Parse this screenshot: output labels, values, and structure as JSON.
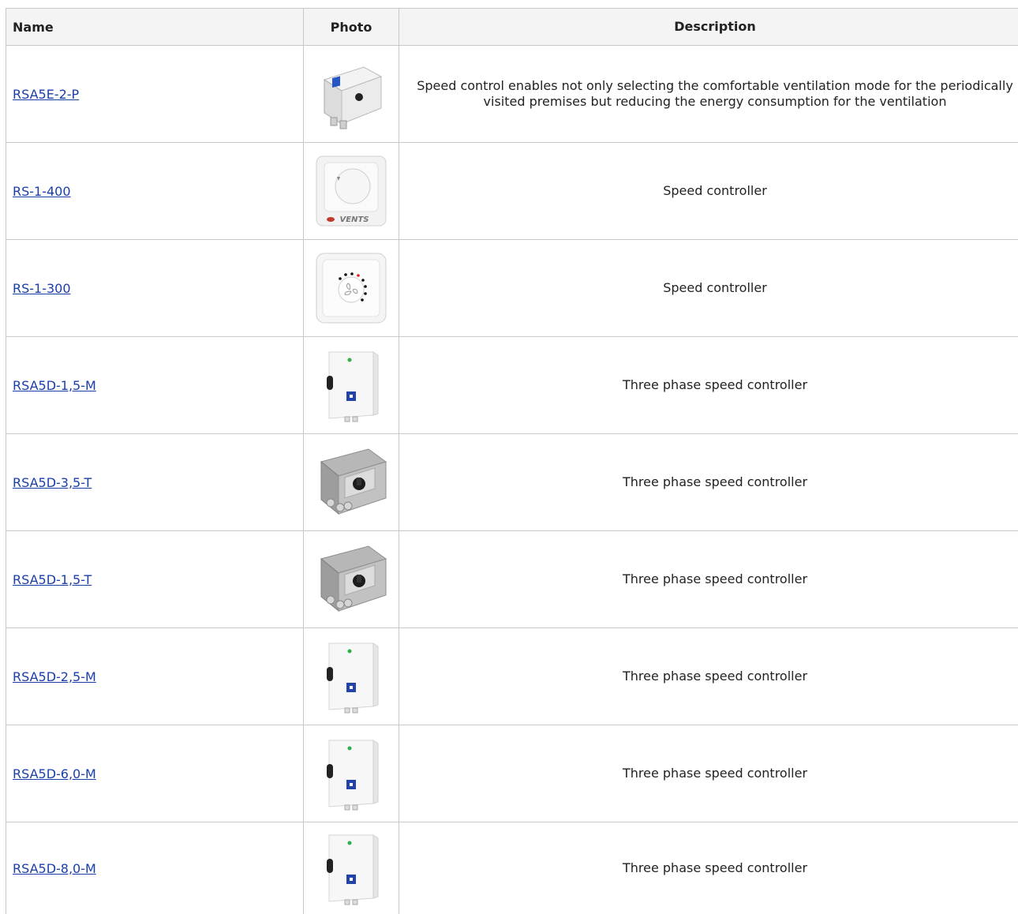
{
  "columns": {
    "name": "Name",
    "photo": "Photo",
    "description": "Description"
  },
  "rows": [
    {
      "name": "RSA5E-2-P",
      "photo_icon": "surface-box-with-switch-icon",
      "description": "Speed control enables not only selecting the comfortable ventilation mode for the periodically visited premises but reducing the energy consumption for the ventilation"
    },
    {
      "name": "RS-1-400",
      "photo_icon": "wall-rotary-dimmer-icon",
      "description": "Speed controller"
    },
    {
      "name": "RS-1-300",
      "photo_icon": "wall-fan-dial-icon",
      "description": "Speed controller"
    },
    {
      "name": "RSA5D-1,5-M",
      "photo_icon": "control-cabinet-icon",
      "description": "Three phase speed controller"
    },
    {
      "name": "RSA5D-3,5-T",
      "photo_icon": "gray-enclosure-knob-icon",
      "description": "Three phase speed controller"
    },
    {
      "name": "RSA5D-1,5-T",
      "photo_icon": "gray-enclosure-knob-icon",
      "description": "Three phase speed controller"
    },
    {
      "name": "RSA5D-2,5-M",
      "photo_icon": "control-cabinet-icon",
      "description": "Three phase speed controller"
    },
    {
      "name": "RSA5D-6,0-M",
      "photo_icon": "control-cabinet-icon",
      "description": "Three phase speed controller"
    },
    {
      "name": "RSA5D-8,0-M",
      "photo_icon": "control-cabinet-icon",
      "description": "Three phase speed controller"
    }
  ]
}
